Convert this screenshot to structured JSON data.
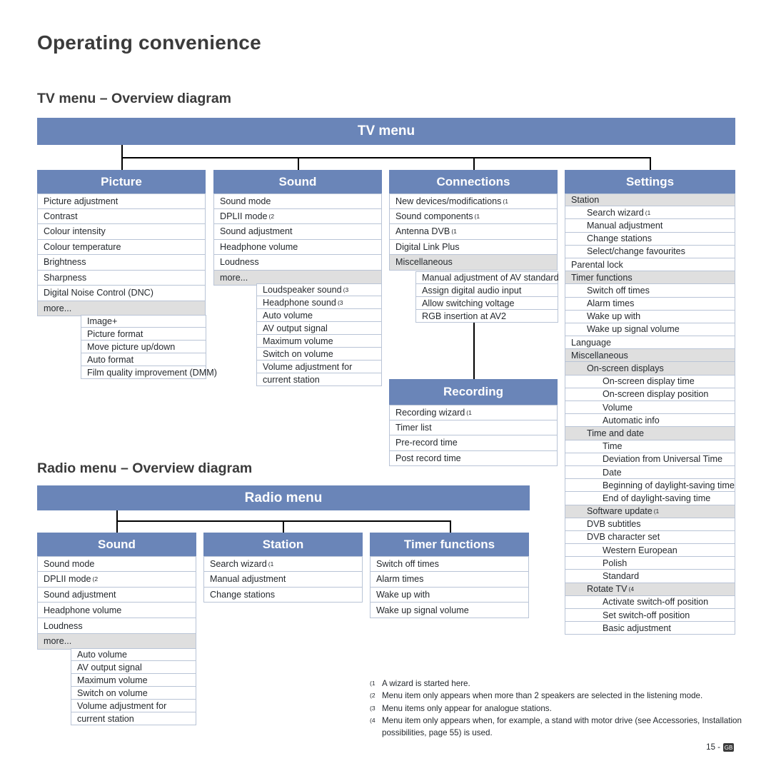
{
  "page": {
    "title": "Operating convenience",
    "page_number": "15 -",
    "page_badge": "GB"
  },
  "sections": {
    "tv": {
      "heading": "TV menu – Overview diagram",
      "root_label": "TV menu"
    },
    "radio": {
      "heading": "Radio menu – Overview diagram",
      "root_label": "Radio menu"
    }
  },
  "tv": {
    "picture": {
      "header": "Picture",
      "items": [
        {
          "label": "Picture adjustment"
        },
        {
          "label": "Contrast"
        },
        {
          "label": "Colour intensity"
        },
        {
          "label": "Colour temperature"
        },
        {
          "label": "Brightness"
        },
        {
          "label": "Sharpness"
        },
        {
          "label": "Digital Noise Control (DNC)"
        },
        {
          "label": "more...",
          "gray": true
        }
      ],
      "sub": [
        {
          "label": "Image+"
        },
        {
          "label": "Picture format"
        },
        {
          "label": "Move picture up/down"
        },
        {
          "label": "Auto format"
        },
        {
          "label": "Film quality improvement (DMM)"
        }
      ]
    },
    "sound": {
      "header": "Sound",
      "items": [
        {
          "label": "Sound mode"
        },
        {
          "label": "DPLII mode",
          "sup": "(2"
        },
        {
          "label": "Sound adjustment"
        },
        {
          "label": "Headphone volume"
        },
        {
          "label": "Loudness"
        },
        {
          "label": "more...",
          "gray": true
        }
      ],
      "sub": [
        {
          "label": "Loudspeaker sound",
          "sup": "(3"
        },
        {
          "label": "Headphone sound",
          "sup": "(3"
        },
        {
          "label": "Auto volume"
        },
        {
          "label": "AV output signal"
        },
        {
          "label": "Maximum volume"
        },
        {
          "label": "Switch on volume"
        },
        {
          "label": "Volume adjustment for"
        },
        {
          "label": "current station"
        }
      ]
    },
    "connections": {
      "header": "Connections",
      "items": [
        {
          "label": "New devices/modifications",
          "sup": "(1"
        },
        {
          "label": "Sound components",
          "sup": "(1"
        },
        {
          "label": "Antenna DVB",
          "sup": "(1"
        },
        {
          "label": "Digital Link Plus"
        },
        {
          "label": "Miscellaneous",
          "gray": true
        }
      ],
      "sub": [
        {
          "label": "Manual adjustment of AV standard"
        },
        {
          "label": "Assign digital audio input"
        },
        {
          "label": "Allow switching voltage"
        },
        {
          "label": "RGB insertion at AV2"
        }
      ]
    },
    "recording": {
      "header": "Recording",
      "items": [
        {
          "label": "Recording wizard",
          "sup": "(1"
        },
        {
          "label": "Timer list"
        },
        {
          "label": "Pre-record time"
        },
        {
          "label": "Post record time"
        }
      ]
    },
    "settings": {
      "header": "Settings",
      "items": [
        {
          "label": "Station",
          "gray": true,
          "indent": 0
        },
        {
          "label": "Search wizard",
          "sup": "(1",
          "indent": 1
        },
        {
          "label": "Manual adjustment",
          "indent": 1
        },
        {
          "label": "Change stations",
          "indent": 1
        },
        {
          "label": "Select/change favourites",
          "indent": 1
        },
        {
          "label": "Parental lock",
          "indent": 0
        },
        {
          "label": "Timer functions",
          "gray": true,
          "indent": 0
        },
        {
          "label": "Switch off times",
          "indent": 1
        },
        {
          "label": "Alarm times",
          "indent": 1
        },
        {
          "label": "Wake up with",
          "indent": 1
        },
        {
          "label": "Wake up signal volume",
          "indent": 1
        },
        {
          "label": "Language",
          "indent": 0
        },
        {
          "label": "Miscellaneous",
          "gray": true,
          "indent": 0
        },
        {
          "label": "On-screen displays",
          "gray": true,
          "indent": 1
        },
        {
          "label": "On-screen display time",
          "indent": 2
        },
        {
          "label": "On-screen display position",
          "indent": 2
        },
        {
          "label": "Volume",
          "indent": 2
        },
        {
          "label": "Automatic info",
          "indent": 2
        },
        {
          "label": "Time and date",
          "gray": true,
          "indent": 1
        },
        {
          "label": "Time",
          "indent": 2
        },
        {
          "label": "Deviation from Universal Time",
          "indent": 2
        },
        {
          "label": "Date",
          "indent": 2
        },
        {
          "label": "Beginning of daylight-saving time",
          "indent": 2
        },
        {
          "label": "End of daylight-saving time",
          "indent": 2
        },
        {
          "label": "Software update",
          "sup": "(1",
          "gray": true,
          "indent": 1
        },
        {
          "label": "DVB subtitles",
          "indent": 1
        },
        {
          "label": "DVB character set",
          "indent": 1
        },
        {
          "label": "Western European",
          "indent": 2
        },
        {
          "label": "Polish",
          "indent": 2
        },
        {
          "label": "Standard",
          "indent": 2
        },
        {
          "label": "Rotate TV",
          "sup": "(4",
          "gray": true,
          "indent": 1
        },
        {
          "label": "Activate switch-off position",
          "indent": 2
        },
        {
          "label": "Set switch-off position",
          "indent": 2
        },
        {
          "label": "Basic adjustment",
          "indent": 2
        }
      ]
    }
  },
  "radio": {
    "sound": {
      "header": "Sound",
      "items": [
        {
          "label": "Sound mode"
        },
        {
          "label": "DPLII mode",
          "sup": "(2"
        },
        {
          "label": "Sound adjustment"
        },
        {
          "label": "Headphone volume"
        },
        {
          "label": "Loudness"
        },
        {
          "label": "more...",
          "gray": true
        }
      ],
      "sub": [
        {
          "label": "Auto volume"
        },
        {
          "label": "AV output signal"
        },
        {
          "label": "Maximum volume"
        },
        {
          "label": "Switch on volume"
        },
        {
          "label": "Volume adjustment for"
        },
        {
          "label": "current station"
        }
      ]
    },
    "station": {
      "header": "Station",
      "items": [
        {
          "label": "Search wizard",
          "sup": "(1"
        },
        {
          "label": "Manual adjustment"
        },
        {
          "label": "Change stations"
        }
      ]
    },
    "timer": {
      "header": "Timer functions",
      "items": [
        {
          "label": "Switch off times"
        },
        {
          "label": "Alarm times"
        },
        {
          "label": "Wake up with"
        },
        {
          "label": "Wake up signal volume"
        }
      ]
    }
  },
  "footnotes": [
    {
      "mark": "(1",
      "text": "A wizard is started here."
    },
    {
      "mark": "(2",
      "text": "Menu item only appears when more than 2 speakers are selected in the listening mode."
    },
    {
      "mark": "(3",
      "text": "Menu items only appear for analogue stations."
    },
    {
      "mark": "(4",
      "text": "Menu item only appears when, for example, a stand with motor drive (see Accessories, Installation possibilities, page 55) is used."
    }
  ],
  "colors": {
    "header_blue": "#6a85b8",
    "row_border": "#b9c4d6",
    "row_gray": "#dfdfdf",
    "title_gray": "#3b3b3b"
  }
}
